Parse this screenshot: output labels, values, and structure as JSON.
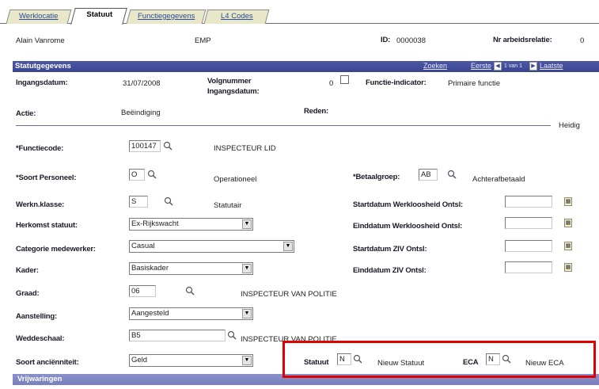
{
  "tabs": [
    {
      "label": "Werklocatie",
      "active": false
    },
    {
      "label": "Statuut",
      "active": true
    },
    {
      "label": "Functiegegevens",
      "active": false
    },
    {
      "label": "L4 Codes",
      "active": false
    }
  ],
  "header": {
    "name": "Alain Vanrome",
    "type": "EMP",
    "id_label": "ID:",
    "id_value": "0000038",
    "relation_label": "Nr arbeidsrelatie:",
    "relation_value": "0"
  },
  "section": {
    "title": "Statutgegevens",
    "search": "Zoeken",
    "first": "Eerste",
    "range": "1 van 1",
    "last": "Laatste"
  },
  "summary": {
    "ingangsdatum_label": "Ingangsdatum:",
    "ingangsdatum_value": "31/07/2008",
    "volgnummer_label": "Volgnummer Ingangsdatum:",
    "volgnummer_value": "0",
    "functie_indicator_label": "Functie-indicator:",
    "functie_indicator_value": "Primaire functie",
    "actie_label": "Actie:",
    "actie_value": "Beëindiging",
    "reden_label": "Reden:",
    "heidig": "Heidig"
  },
  "fields": {
    "functiecode_label": "*Functiecode:",
    "functiecode_value": "100147",
    "functiecode_desc": "INSPECTEUR LID",
    "soort_personeel_label": "*Soort Personeel:",
    "soort_personeel_value": "O",
    "soort_personeel_desc": "Operationeel",
    "betaalgroep_label": "*Betaalgroep:",
    "betaalgroep_value": "AB",
    "betaalgroep_desc": "Achterafbetaald",
    "werkn_klasse_label": "Werkn.klasse:",
    "werkn_klasse_value": "S",
    "werkn_klasse_desc": "Statutair",
    "startdatum_werkloosheid_label": "Startdatum Werkloosheid Ontsl:",
    "herkomst_label": "Herkomst statuut:",
    "herkomst_value": "Ex-Rijkswacht",
    "einddatum_werkloosheid_label": "Einddatum Werkloosheid Ontsl:",
    "categorie_label": "Categorie medewerker:",
    "categorie_value": "Casual",
    "startdatum_ziv_label": "Startdatum ZIV Ontsl:",
    "kader_label": "Kader:",
    "kader_value": "Basiskader",
    "einddatum_ziv_label": "Einddatum ZIV Ontsl:",
    "graad_label": "Graad:",
    "graad_value": "06",
    "graad_desc": "INSPECTEUR VAN POLITIE",
    "aanstelling_label": "Aanstelling:",
    "aanstelling_value": "Aangesteld",
    "weddeschaal_label": "Weddeschaal:",
    "weddeschaal_value": "B5",
    "weddeschaal_desc": "INSPECTEUR VAN POLITIE",
    "soort_anciennitei_label": "Soort anciënniteit:",
    "soort_anciennitei_value": "Geld",
    "statuut_label": "Statuut",
    "statuut_value": "N",
    "statuut_desc": "Nieuw Statuut",
    "eca_label": "ECA",
    "eca_value": "N",
    "eca_desc": "Nieuw ECA"
  },
  "bottom": {
    "title": "Vrijwaringen"
  }
}
